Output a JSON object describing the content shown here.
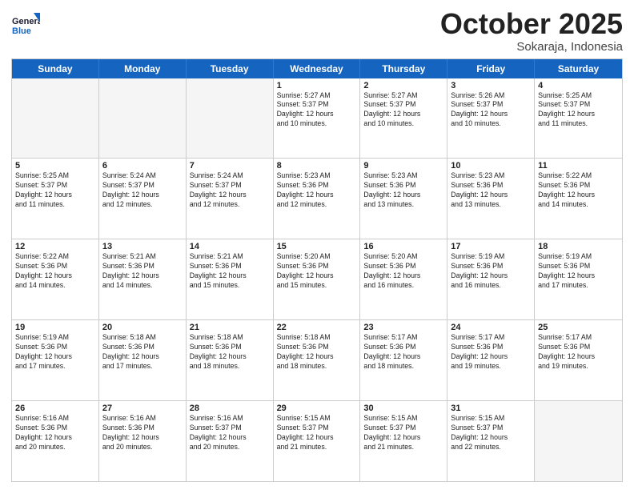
{
  "header": {
    "logo_line1": "General",
    "logo_line2": "Blue",
    "month_title": "October 2025",
    "subtitle": "Sokaraja, Indonesia"
  },
  "weekdays": [
    "Sunday",
    "Monday",
    "Tuesday",
    "Wednesday",
    "Thursday",
    "Friday",
    "Saturday"
  ],
  "rows": [
    [
      {
        "day": "",
        "text": ""
      },
      {
        "day": "",
        "text": ""
      },
      {
        "day": "",
        "text": ""
      },
      {
        "day": "1",
        "text": "Sunrise: 5:27 AM\nSunset: 5:37 PM\nDaylight: 12 hours\nand 10 minutes."
      },
      {
        "day": "2",
        "text": "Sunrise: 5:27 AM\nSunset: 5:37 PM\nDaylight: 12 hours\nand 10 minutes."
      },
      {
        "day": "3",
        "text": "Sunrise: 5:26 AM\nSunset: 5:37 PM\nDaylight: 12 hours\nand 10 minutes."
      },
      {
        "day": "4",
        "text": "Sunrise: 5:25 AM\nSunset: 5:37 PM\nDaylight: 12 hours\nand 11 minutes."
      }
    ],
    [
      {
        "day": "5",
        "text": "Sunrise: 5:25 AM\nSunset: 5:37 PM\nDaylight: 12 hours\nand 11 minutes."
      },
      {
        "day": "6",
        "text": "Sunrise: 5:24 AM\nSunset: 5:37 PM\nDaylight: 12 hours\nand 12 minutes."
      },
      {
        "day": "7",
        "text": "Sunrise: 5:24 AM\nSunset: 5:37 PM\nDaylight: 12 hours\nand 12 minutes."
      },
      {
        "day": "8",
        "text": "Sunrise: 5:23 AM\nSunset: 5:36 PM\nDaylight: 12 hours\nand 12 minutes."
      },
      {
        "day": "9",
        "text": "Sunrise: 5:23 AM\nSunset: 5:36 PM\nDaylight: 12 hours\nand 13 minutes."
      },
      {
        "day": "10",
        "text": "Sunrise: 5:23 AM\nSunset: 5:36 PM\nDaylight: 12 hours\nand 13 minutes."
      },
      {
        "day": "11",
        "text": "Sunrise: 5:22 AM\nSunset: 5:36 PM\nDaylight: 12 hours\nand 14 minutes."
      }
    ],
    [
      {
        "day": "12",
        "text": "Sunrise: 5:22 AM\nSunset: 5:36 PM\nDaylight: 12 hours\nand 14 minutes."
      },
      {
        "day": "13",
        "text": "Sunrise: 5:21 AM\nSunset: 5:36 PM\nDaylight: 12 hours\nand 14 minutes."
      },
      {
        "day": "14",
        "text": "Sunrise: 5:21 AM\nSunset: 5:36 PM\nDaylight: 12 hours\nand 15 minutes."
      },
      {
        "day": "15",
        "text": "Sunrise: 5:20 AM\nSunset: 5:36 PM\nDaylight: 12 hours\nand 15 minutes."
      },
      {
        "day": "16",
        "text": "Sunrise: 5:20 AM\nSunset: 5:36 PM\nDaylight: 12 hours\nand 16 minutes."
      },
      {
        "day": "17",
        "text": "Sunrise: 5:19 AM\nSunset: 5:36 PM\nDaylight: 12 hours\nand 16 minutes."
      },
      {
        "day": "18",
        "text": "Sunrise: 5:19 AM\nSunset: 5:36 PM\nDaylight: 12 hours\nand 17 minutes."
      }
    ],
    [
      {
        "day": "19",
        "text": "Sunrise: 5:19 AM\nSunset: 5:36 PM\nDaylight: 12 hours\nand 17 minutes."
      },
      {
        "day": "20",
        "text": "Sunrise: 5:18 AM\nSunset: 5:36 PM\nDaylight: 12 hours\nand 17 minutes."
      },
      {
        "day": "21",
        "text": "Sunrise: 5:18 AM\nSunset: 5:36 PM\nDaylight: 12 hours\nand 18 minutes."
      },
      {
        "day": "22",
        "text": "Sunrise: 5:18 AM\nSunset: 5:36 PM\nDaylight: 12 hours\nand 18 minutes."
      },
      {
        "day": "23",
        "text": "Sunrise: 5:17 AM\nSunset: 5:36 PM\nDaylight: 12 hours\nand 18 minutes."
      },
      {
        "day": "24",
        "text": "Sunrise: 5:17 AM\nSunset: 5:36 PM\nDaylight: 12 hours\nand 19 minutes."
      },
      {
        "day": "25",
        "text": "Sunrise: 5:17 AM\nSunset: 5:36 PM\nDaylight: 12 hours\nand 19 minutes."
      }
    ],
    [
      {
        "day": "26",
        "text": "Sunrise: 5:16 AM\nSunset: 5:36 PM\nDaylight: 12 hours\nand 20 minutes."
      },
      {
        "day": "27",
        "text": "Sunrise: 5:16 AM\nSunset: 5:36 PM\nDaylight: 12 hours\nand 20 minutes."
      },
      {
        "day": "28",
        "text": "Sunrise: 5:16 AM\nSunset: 5:37 PM\nDaylight: 12 hours\nand 20 minutes."
      },
      {
        "day": "29",
        "text": "Sunrise: 5:15 AM\nSunset: 5:37 PM\nDaylight: 12 hours\nand 21 minutes."
      },
      {
        "day": "30",
        "text": "Sunrise: 5:15 AM\nSunset: 5:37 PM\nDaylight: 12 hours\nand 21 minutes."
      },
      {
        "day": "31",
        "text": "Sunrise: 5:15 AM\nSunset: 5:37 PM\nDaylight: 12 hours\nand 22 minutes."
      },
      {
        "day": "",
        "text": ""
      }
    ]
  ]
}
